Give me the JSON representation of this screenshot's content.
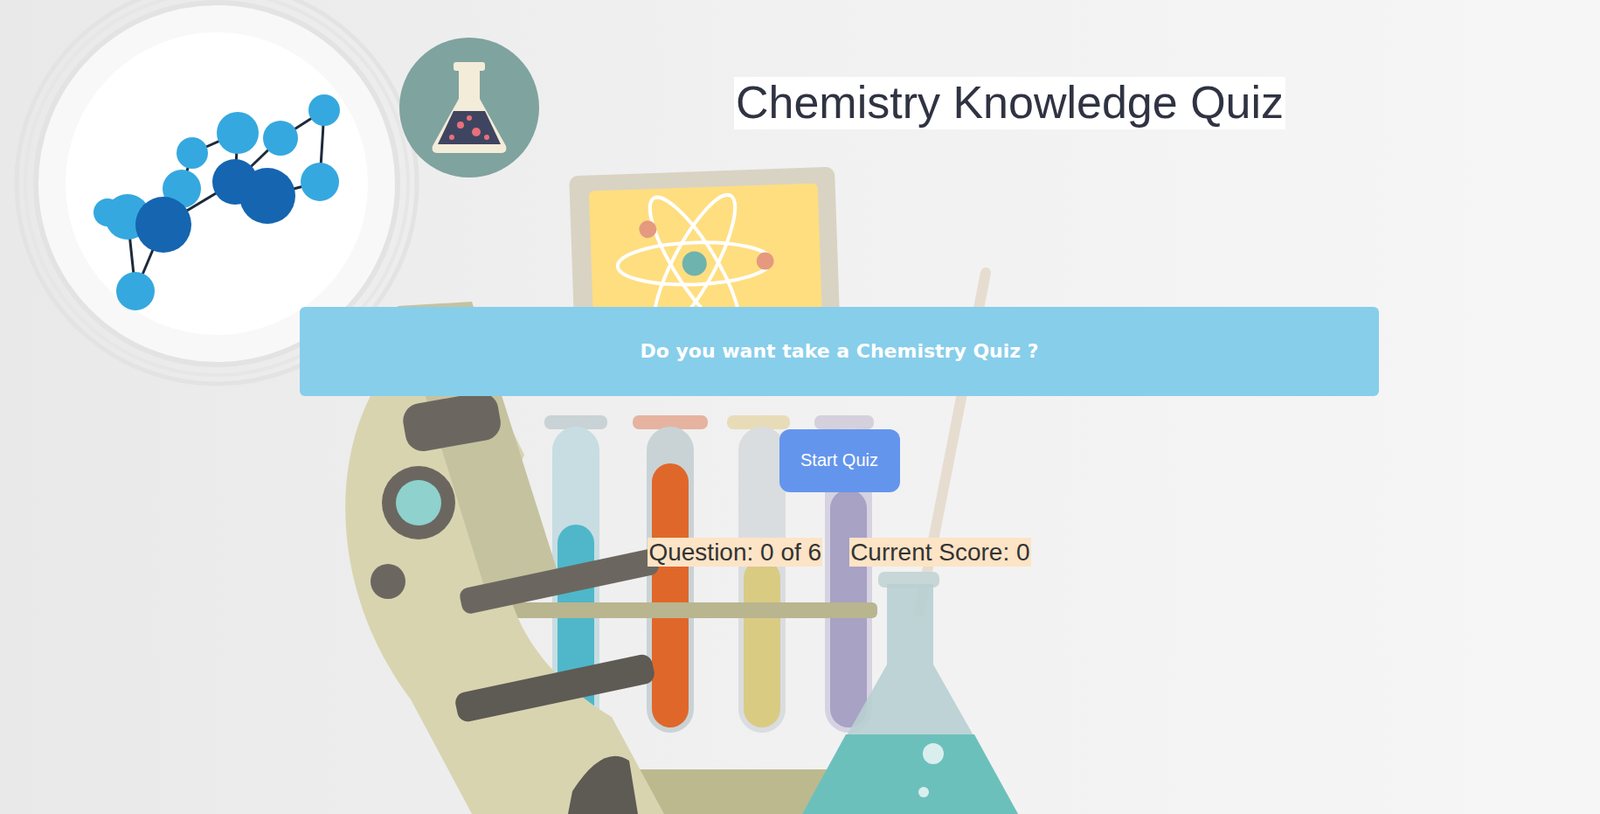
{
  "title": "Chemistry Knowledge Quiz",
  "banner": {
    "question": "Do you want take a Chemistry Quiz ?"
  },
  "start_button": {
    "label": "Start Quiz"
  },
  "status": {
    "progress": "Question: 0 of 6",
    "score": "Current Score: 0"
  }
}
